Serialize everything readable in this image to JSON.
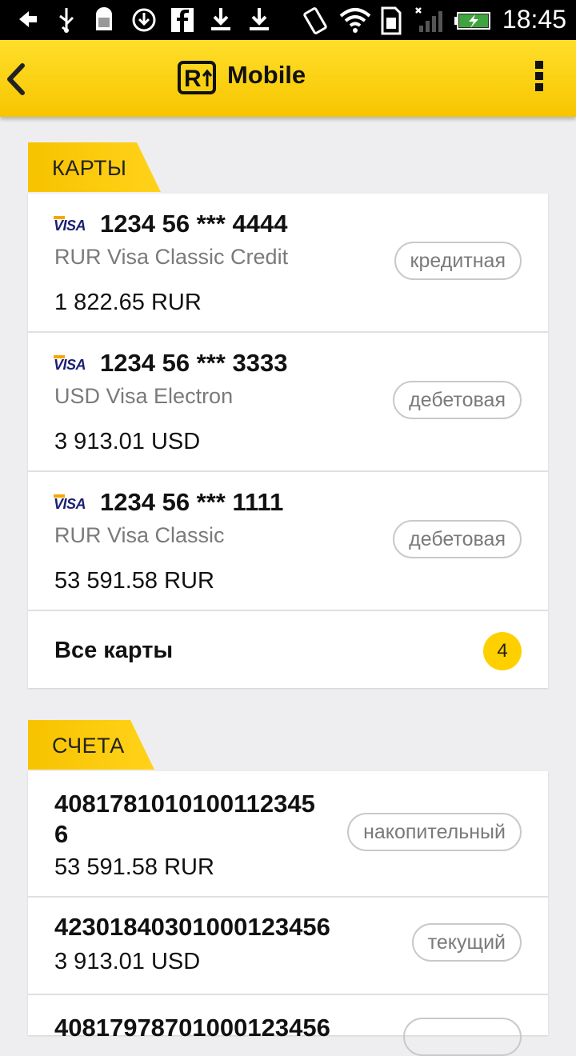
{
  "status_bar": {
    "time": "18:45",
    "icons": [
      "back-arrow-icon",
      "usb-icon",
      "android-debug-icon",
      "sync-icon",
      "facebook-icon",
      "download-icon",
      "download-icon",
      "rotate-icon",
      "wifi-icon",
      "sim-icon",
      "signal-icon",
      "battery-charging-icon"
    ]
  },
  "app_bar": {
    "logo_letter": "R",
    "logo_text": "Mobile",
    "back_icon": "chevron-left-icon",
    "menu_icon": "overflow-menu-icon"
  },
  "cards_section": {
    "title": "КАРТЫ",
    "cards": [
      {
        "brand": "VISA",
        "number": "1234 56 *** 4444",
        "type": "RUR Visa Classic Credit",
        "balance": "1 822.65 RUR",
        "badge": "кредитная"
      },
      {
        "brand": "VISA",
        "number": "1234 56 *** 3333",
        "type": "USD Visa Electron",
        "balance": "3 913.01 USD",
        "badge": "дебетовая"
      },
      {
        "brand": "VISA",
        "number": "1234 56 *** 1111",
        "type": "RUR Visa Classic",
        "balance": "53 591.58 RUR",
        "badge": "дебетовая"
      }
    ],
    "all_label": "Все карты",
    "all_count": "4"
  },
  "accounts_section": {
    "title": "СЧЕТА",
    "accounts": [
      {
        "number": "40817810101001123456",
        "balance": "53 591.58 RUR",
        "badge": "накопительный"
      },
      {
        "number": "42301840301000123456",
        "balance": "3 913.01 USD",
        "badge": "текущий"
      },
      {
        "number": "40817978701000123456",
        "balance": "",
        "badge": ""
      }
    ]
  },
  "colors": {
    "accent": "#ffd000",
    "appbar": "#f7c500",
    "muted_text": "#7a7a7a"
  }
}
